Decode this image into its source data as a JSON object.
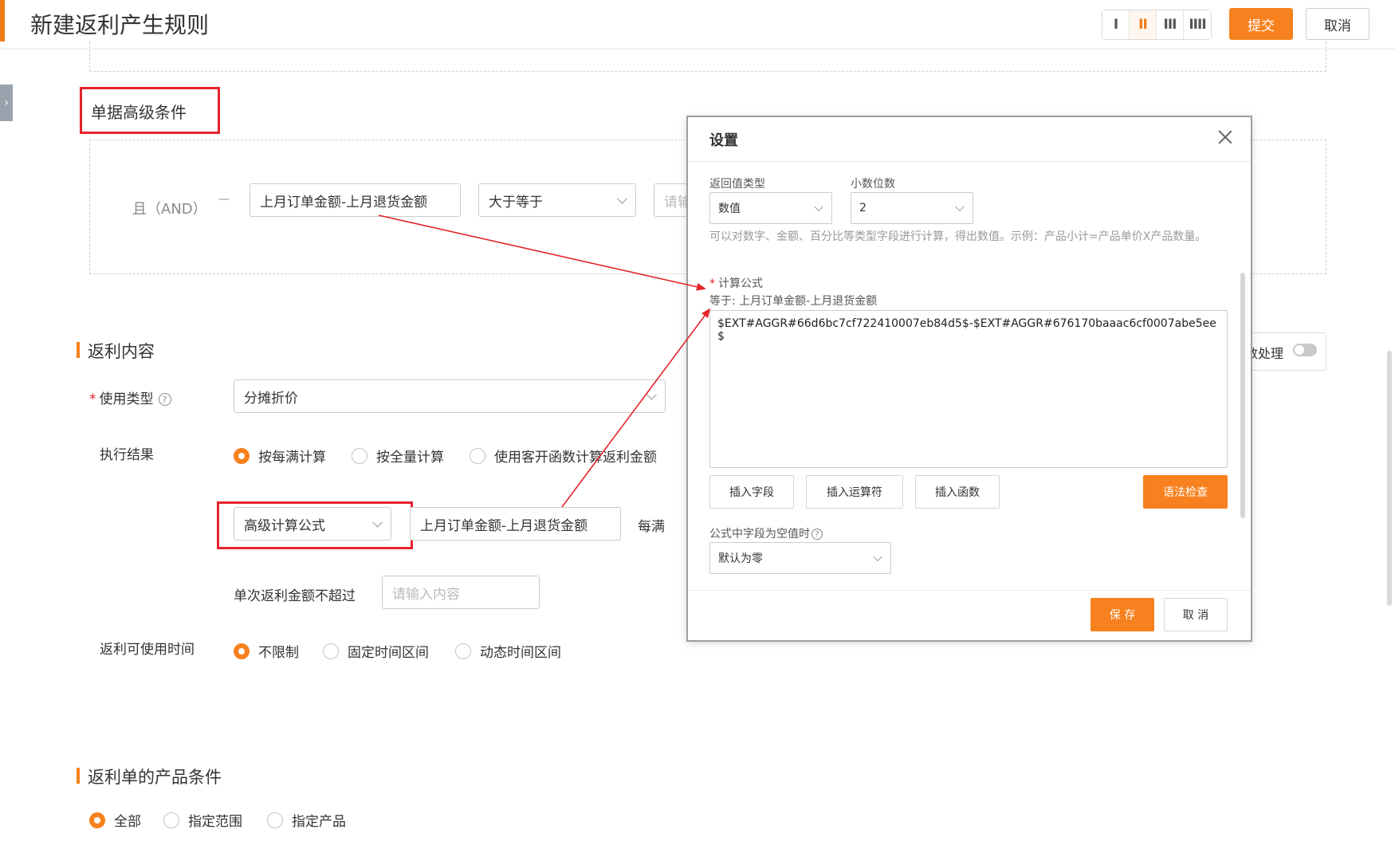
{
  "header": {
    "title": "新建返利产生规则",
    "layout_options": [
      "I",
      "II",
      "III",
      "IIII"
    ],
    "active_layout": "II",
    "submit_label": "提交",
    "cancel_label": "取消"
  },
  "side_handle_glyph": "›",
  "advanced_conditions": {
    "title": "单据高级条件",
    "logic_label": "且（AND）",
    "connector": "—",
    "field_value": "上月订单金额-上月退货金额",
    "operator_value": "大于等于",
    "value_placeholder": "请输"
  },
  "rebate_content": {
    "title": "返利内容",
    "usage_type_label": "使用类型",
    "usage_type_value": "分摊折价",
    "exec_result_label": "执行结果",
    "exec_options": [
      "按每满计算",
      "按全量计算",
      "使用客开函数计算返利金额"
    ],
    "exec_selected": 0,
    "calc_mode_value": "高级计算公式",
    "formula_field_value": "上月订单金额-上月退货金额",
    "per_full_label": "每满",
    "single_max_label": "单次返利金额不超过",
    "single_max_placeholder": "请输入内容",
    "usable_time_label": "返利可使用时间",
    "time_options": [
      "不限制",
      "固定时间区间",
      "动态时间区间"
    ],
    "time_selected": 0,
    "decimal_toggle_label": "数处理",
    "decimal_toggle_on": false
  },
  "product_conditions": {
    "title": "返利单的产品条件",
    "options": [
      "全部",
      "指定范围",
      "指定产品"
    ],
    "selected": 0
  },
  "dialog": {
    "title": "设置",
    "return_type_label": "返回值类型",
    "return_type_value": "数值",
    "decimals_label": "小数位数",
    "decimals_value": "2",
    "hint": "可以对数字、金额、百分比等类型字段进行计算，得出数值。示例：产品小计=产品单价X产品数量。",
    "formula_label": "计算公式",
    "equals_text": "等于: 上月订单金额-上月退货金额",
    "formula": "$EXT#AGGR#66d6bc7cf722410007eb84d5$-$EXT#AGGR#676170baaac6cf0007abe5ee$",
    "insert_field_label": "插入字段",
    "insert_operator_label": "插入运算符",
    "insert_function_label": "插入函数",
    "syntax_check_label": "语法检查",
    "empty_field_label": "公式中字段为空值时",
    "empty_field_value": "默认为零",
    "save_label": "保 存",
    "cancel_label": "取 消"
  },
  "colors": {
    "accent": "#f7811e",
    "annotation_red": "#e5242b"
  }
}
